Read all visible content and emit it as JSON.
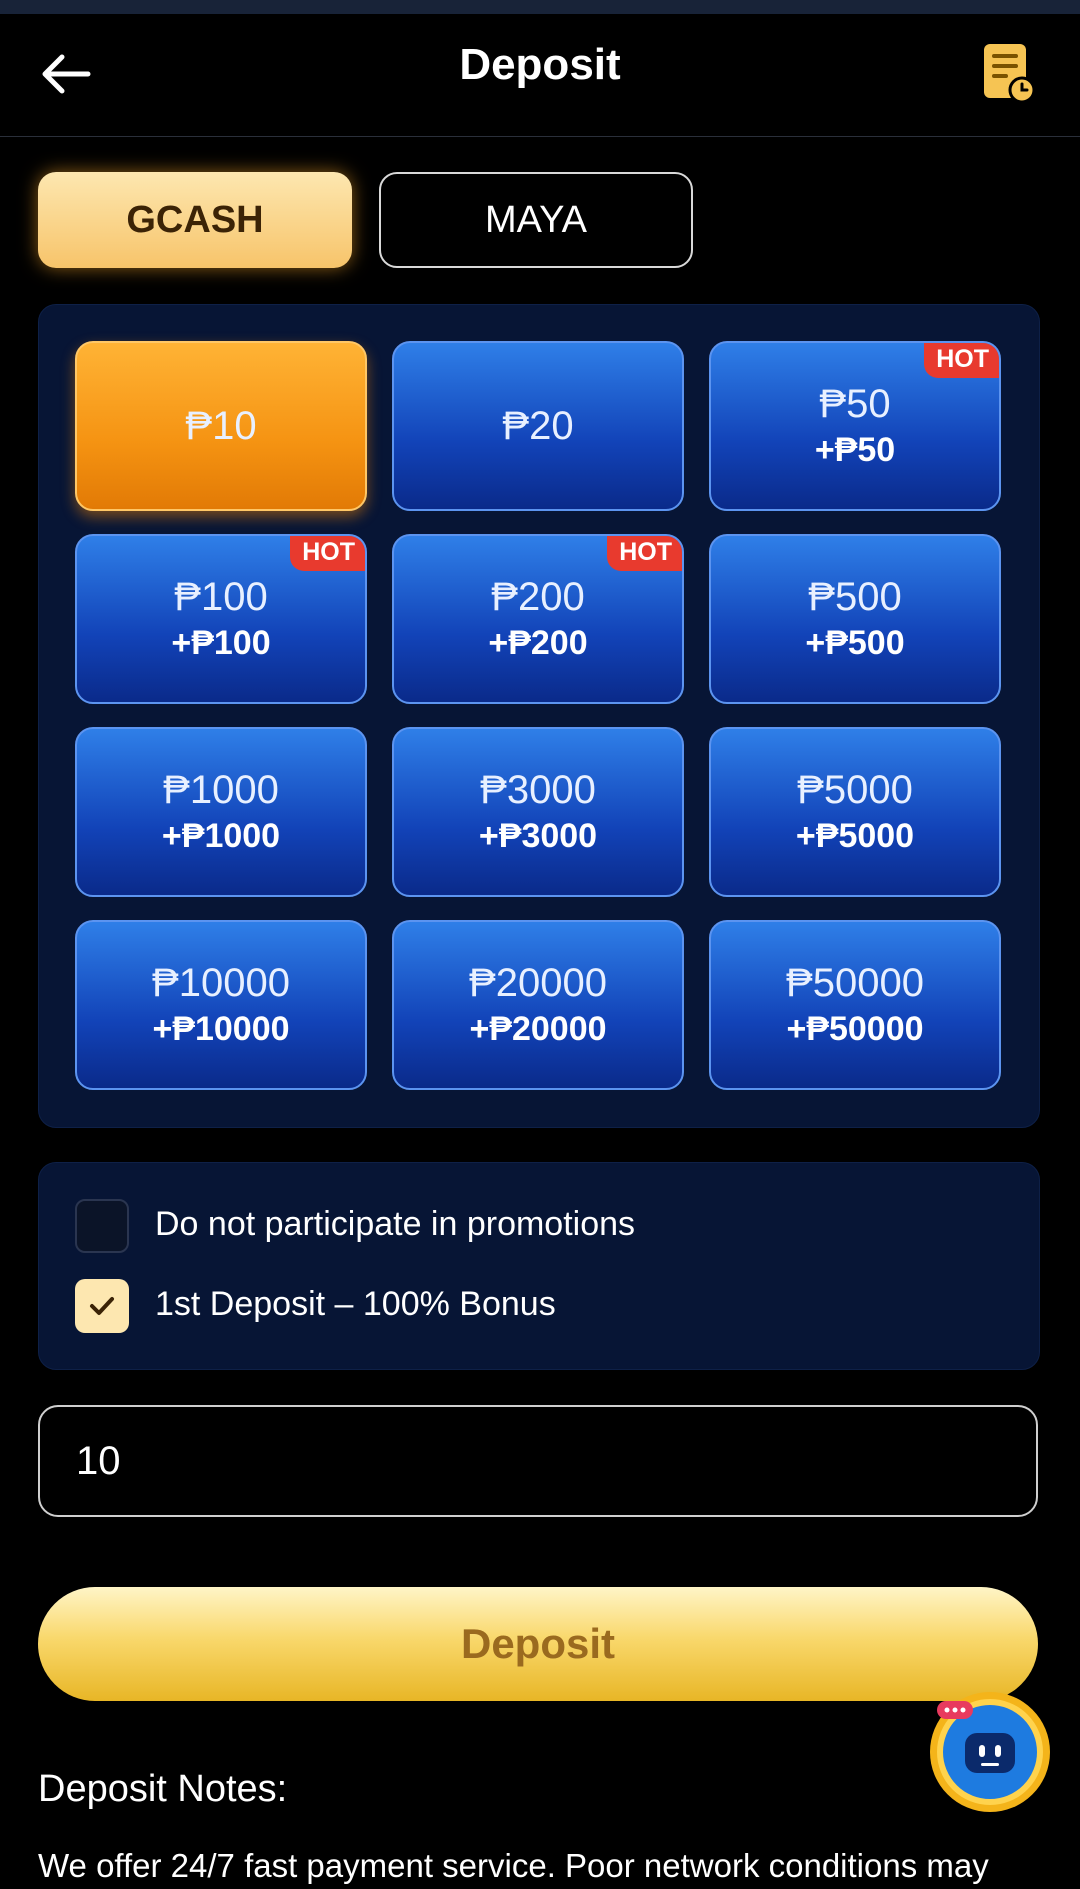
{
  "header": {
    "title": "Deposit"
  },
  "payment_tabs": [
    {
      "label": "GCASH",
      "selected": true
    },
    {
      "label": "MAYA",
      "selected": false
    }
  ],
  "amounts": [
    {
      "amount": "₱10",
      "bonus": "",
      "hot": ""
    },
    {
      "amount": "₱20",
      "bonus": "",
      "hot": ""
    },
    {
      "amount": "₱50",
      "bonus": "+₱50",
      "hot": "HOT"
    },
    {
      "amount": "₱100",
      "bonus": "+₱100",
      "hot": "HOT"
    },
    {
      "amount": "₱200",
      "bonus": "+₱200",
      "hot": "HOT"
    },
    {
      "amount": "₱500",
      "bonus": "+₱500",
      "hot": ""
    },
    {
      "amount": "₱1000",
      "bonus": "+₱1000",
      "hot": ""
    },
    {
      "amount": "₱3000",
      "bonus": "+₱3000",
      "hot": ""
    },
    {
      "amount": "₱5000",
      "bonus": "+₱5000",
      "hot": ""
    },
    {
      "amount": "₱10000",
      "bonus": "+₱10000",
      "hot": ""
    },
    {
      "amount": "₱20000",
      "bonus": "+₱20000",
      "hot": ""
    },
    {
      "amount": "₱50000",
      "bonus": "+₱50000",
      "hot": ""
    }
  ],
  "selected_amount_index": 0,
  "promotions": [
    {
      "label": "Do not participate in promotions",
      "checked": false
    },
    {
      "label": "1st Deposit – 100% Bonus",
      "checked": true
    }
  ],
  "amount_input": {
    "value": "10"
  },
  "deposit_button": {
    "label": "Deposit"
  },
  "notes": {
    "title": "Deposit Notes:",
    "text": "We offer 24/7 fast payment service. Poor network conditions may"
  },
  "icons": {
    "back": "arrow-left-icon",
    "record": "deposit-record-icon",
    "support": "support-chat-icon"
  },
  "colors": {
    "selected_tab": "#f7c46a",
    "amount_button": "#1243b8",
    "selected_amount": "#f59312",
    "hot_badge": "#e83a2e",
    "deposit_button": "#f9d86c"
  }
}
